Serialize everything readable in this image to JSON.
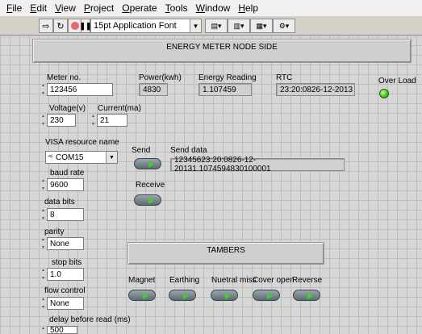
{
  "menu": [
    {
      "label": "File",
      "ul": "F",
      "rest": "ile"
    },
    {
      "label": "Edit",
      "ul": "E",
      "rest": "dit"
    },
    {
      "label": "View",
      "ul": "V",
      "rest": "iew"
    },
    {
      "label": "Project",
      "ul": "P",
      "rest": "roject"
    },
    {
      "label": "Operate",
      "ul": "O",
      "rest": "perate"
    },
    {
      "label": "Tools",
      "ul": "T",
      "rest": "ools"
    },
    {
      "label": "Window",
      "ul": "W",
      "rest": "indow"
    },
    {
      "label": "Help",
      "ul": "H",
      "rest": "elp"
    }
  ],
  "toolbar": {
    "font_selector": "15pt Application Font"
  },
  "panel": {
    "title": "ENERGY METER NODE SIDE",
    "meter_no": {
      "label": "Meter no.",
      "value": "123456"
    },
    "power": {
      "label": "Power(kwh)",
      "value": "4830"
    },
    "energy": {
      "label": "Energy Reading",
      "value": "1.107459"
    },
    "rtc": {
      "label": "RTC",
      "value": "23:20:0826-12-2013"
    },
    "overload": {
      "label": "Over Load"
    },
    "voltage": {
      "label": "Voltage(v)",
      "value": "230"
    },
    "current": {
      "label": "Current(ma)",
      "value": "21"
    },
    "visa": {
      "label": "VISA resource name",
      "value": "COM15"
    },
    "baud": {
      "label": "baud rate",
      "value": "9600"
    },
    "databits": {
      "label": "data bits",
      "value": "8"
    },
    "parity": {
      "label": "parity",
      "value": "None"
    },
    "stopbits": {
      "label": "stop bits",
      "value": "1.0"
    },
    "flow": {
      "label": "flow control",
      "value": "None"
    },
    "delay": {
      "label": "delay before read (ms)",
      "value": "500"
    },
    "send": {
      "label": "Send"
    },
    "send_data": {
      "label": "Send data",
      "value": "12345623:20:0826-12-20131.1074594830100001"
    },
    "receive": {
      "label": "Receive"
    },
    "tambers_title": "TAMBERS",
    "tambers": [
      "Magnet",
      "Earthing",
      "Nuetral miss",
      "Cover open",
      "Reverse"
    ]
  },
  "colors": {
    "led_on": "#3fc21a",
    "run_arrow": "#3bd12a"
  }
}
